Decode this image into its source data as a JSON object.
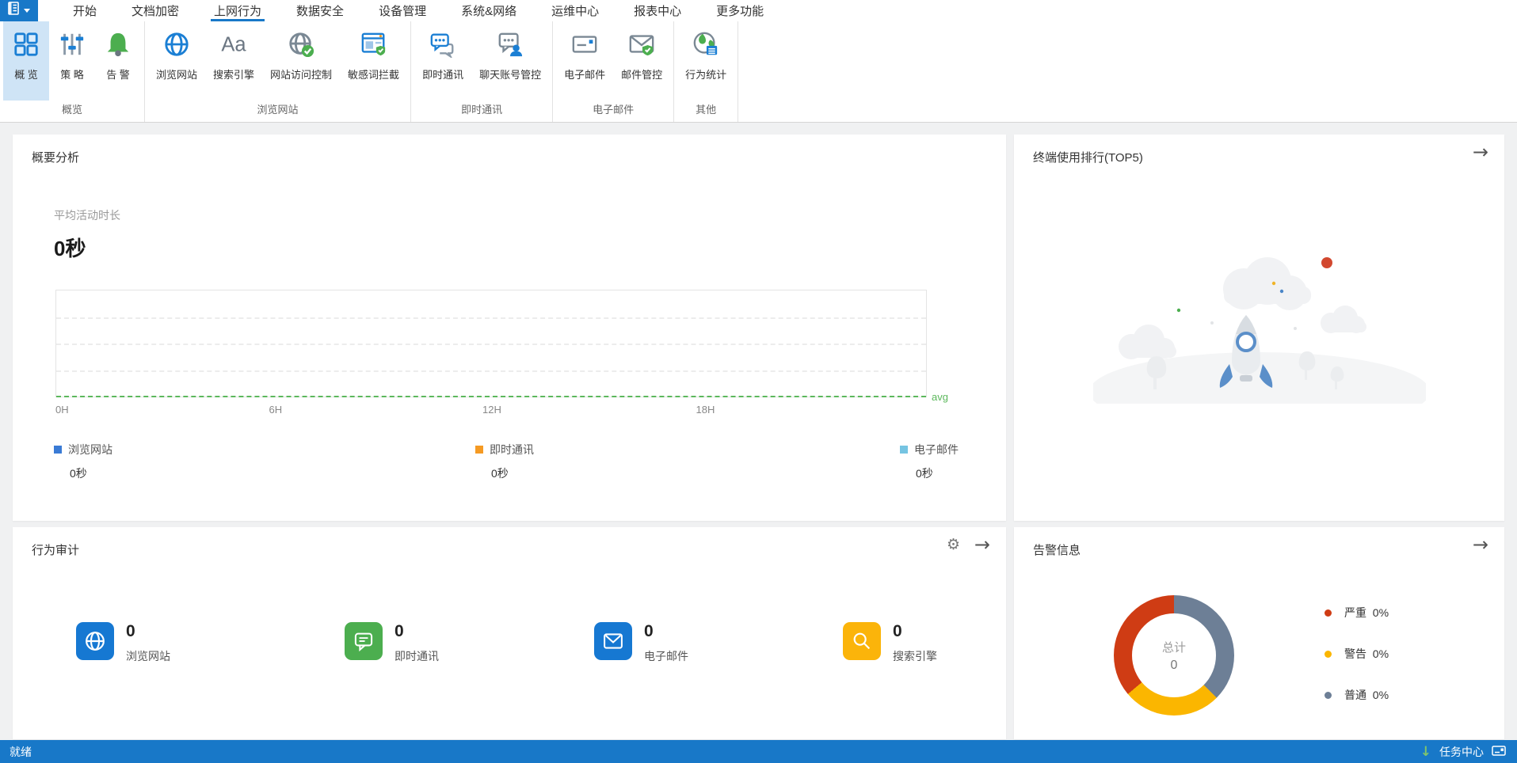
{
  "menu": {
    "tabs": [
      {
        "label": "开始"
      },
      {
        "label": "文档加密"
      },
      {
        "label": "上网行为"
      },
      {
        "label": "数据安全"
      },
      {
        "label": "设备管理"
      },
      {
        "label": "系统&网络"
      },
      {
        "label": "运维中心"
      },
      {
        "label": "报表中心"
      },
      {
        "label": "更多功能"
      }
    ],
    "active_tab": "上网行为"
  },
  "ribbon": {
    "groups": [
      {
        "label": "概览",
        "items": [
          {
            "label": "概 览",
            "icon": "overview-grid-icon",
            "selected": true
          },
          {
            "label": "策 略",
            "icon": "policy-sliders-icon"
          },
          {
            "label": "告 警",
            "icon": "alert-bell-icon"
          }
        ]
      },
      {
        "label": "浏览网站",
        "items": [
          {
            "label": "浏览网站",
            "icon": "browse-globe-icon"
          },
          {
            "label": "搜索引擎",
            "icon": "search-engine-icon"
          },
          {
            "label": "网站访问控制",
            "icon": "site-access-control-icon"
          },
          {
            "label": "敏感词拦截",
            "icon": "sensitive-word-block-icon"
          }
        ]
      },
      {
        "label": "即时通讯",
        "items": [
          {
            "label": "即时通讯",
            "icon": "im-chat-icon"
          },
          {
            "label": "聊天账号管控",
            "icon": "chat-account-icon"
          }
        ]
      },
      {
        "label": "电子邮件",
        "items": [
          {
            "label": "电子邮件",
            "icon": "email-icon"
          },
          {
            "label": "邮件管控",
            "icon": "mail-control-icon"
          }
        ]
      },
      {
        "label": "其他",
        "items": [
          {
            "label": "行为统计",
            "icon": "behavior-stats-icon"
          }
        ]
      }
    ]
  },
  "summary_card": {
    "title": "概要分析",
    "metric_label": "平均活动时长",
    "metric_value": "0秒",
    "avg_label": "avg",
    "x_ticks": {
      "t0": "0H",
      "t1": "6H",
      "t2": "12H",
      "t3": "18H"
    },
    "legend": [
      {
        "label": "浏览网站",
        "value": "0秒",
        "color": "#3a7bd5"
      },
      {
        "label": "即时通讯",
        "value": "0秒",
        "color": "#f59a23"
      },
      {
        "label": "电子邮件",
        "value": "0秒",
        "color": "#76c4e2"
      }
    ]
  },
  "chart_data": [
    {
      "type": "line",
      "title": "平均活动时长",
      "x_ticks": [
        "0H",
        "6H",
        "12H",
        "18H"
      ],
      "x_range_hours": [
        0,
        24
      ],
      "grid": "dashed-horizontal, 3 lines",
      "series": [
        {
          "name": "浏览网站",
          "color": "#3a7bd5",
          "value_seconds": 0,
          "values": "all 0 (no line drawn)"
        },
        {
          "name": "即时通讯",
          "color": "#f59a23",
          "value_seconds": 0,
          "values": "all 0 (no line drawn)"
        },
        {
          "name": "电子邮件",
          "color": "#76c4e2",
          "value_seconds": 0,
          "values": "all 0 (no line drawn)"
        }
      ],
      "avg_line": {
        "label": "avg",
        "value": 0,
        "color": "#5cb85c",
        "style": "dashed",
        "position": "bottom"
      }
    },
    {
      "type": "pie",
      "title": "告警信息",
      "center_label": "总计",
      "center_value": 0,
      "slices": [
        {
          "label": "严重",
          "pct": 0,
          "color": "#cf3c14"
        },
        {
          "label": "警告",
          "pct": 0,
          "color": "#fbb600"
        },
        {
          "label": "普通",
          "pct": 0,
          "color": "#6d7f96"
        }
      ],
      "note": "all values 0; ring shown as placeholder thirds (slate/yellow/red)",
      "legend_position": "right"
    }
  ],
  "top5_card": {
    "title": "终端使用排行(TOP5)"
  },
  "audit_card": {
    "title": "行为审计",
    "stats": [
      {
        "label": "浏览网站",
        "value": "0",
        "color": "#1678d2",
        "icon": "globe-stat-icon"
      },
      {
        "label": "即时通讯",
        "value": "0",
        "color": "#4cae4f",
        "icon": "chat-stat-icon"
      },
      {
        "label": "电子邮件",
        "value": "0",
        "color": "#1678d2",
        "icon": "mail-stat-icon"
      },
      {
        "label": "搜索引擎",
        "value": "0",
        "color": "#fbb40a",
        "icon": "search-stat-icon"
      }
    ]
  },
  "alerts_card": {
    "title": "告警信息",
    "donut_center_label": "总计",
    "donut_center_value": "0",
    "legend": [
      {
        "label": "严重",
        "value": "0%",
        "color": "#cf3c14"
      },
      {
        "label": "警告",
        "value": "0%",
        "color": "#fbb600"
      },
      {
        "label": "普通",
        "value": "0%",
        "color": "#6d7f96"
      }
    ]
  },
  "statusbar": {
    "left": "就绪",
    "task_center": "任务中心"
  },
  "colors": {
    "accent_blue": "#1878c8",
    "selected_item_bg": "#cfe4f6",
    "statusbar_bg": "#1878c8",
    "content_bg": "#f0f1f2"
  }
}
